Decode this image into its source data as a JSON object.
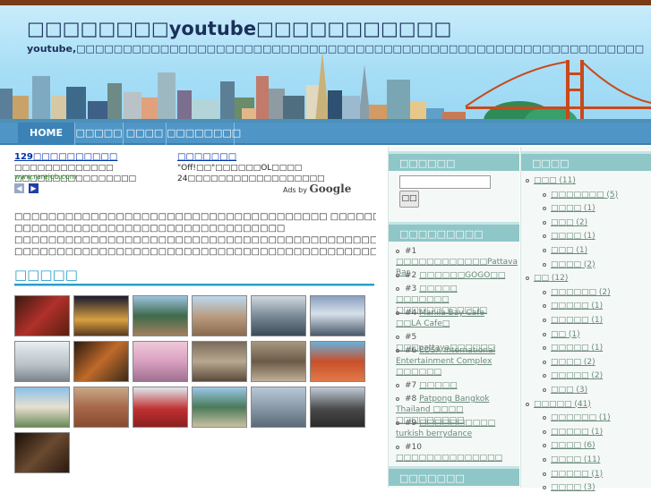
{
  "header": {
    "title": "□□□□□□□□youtube□□□□□□□□□□□",
    "description": "youtube,□□□□□□□□□□□□□□□□□□□□□□□□□□□□□□□□□□□□□□□□□□□□□□□□□□□□□□□□□□□□□□"
  },
  "nav": {
    "items": [
      "HOME",
      "□□□□□",
      "□□□□",
      "□□□□□□□□"
    ]
  },
  "ads": {
    "ad1": {
      "title": "129□□□□□□□□□□",
      "text": "□□□□□□□□□□□□□ □□□□□□□□□□□□□□□□",
      "url": "www.rarejob.com"
    },
    "ad2": {
      "title": "□□□□□□□",
      "text": "\"Off!□□\"□□□□□□OL□□□□ 24□□□□□□□□□□□□□□□□□□"
    },
    "ads_by": "Ads by",
    "ads_by_brand": "Google"
  },
  "main": {
    "paragraphs": [
      "□□□□□□□□□□□□□□□□□□□□□□□□□□□□□□□□□□□□□ □□□□□□□□□□□□□□□□□□□□□□□□□□□□□□□□",
      "□□□□□□□□□□□□□□□□□□□□□□□□□□□□□□□□",
      "□□□□□□□□□□□□□□□□□□□□□□□□□□□□□□□□□□□□□□□□□□□□□□□",
      "□□□□□□□□□□□□□□□□□□□□□□□□□□□□□□□□□□□□□□□□□□□□□□□□□□□□□□□□□□□□□□□□□□□□□□□□"
    ],
    "photos_heading": "□□□□□"
  },
  "sidebar_left": {
    "search_title": "□□□□□□",
    "search_button": "□□",
    "ranking_title": "□□□□□□□□□",
    "ranking": [
      {
        "num": "#1",
        "text": "□□□□□□□□□□□□Pattava Bar"
      },
      {
        "num": "#2",
        "text": "□□□□□□GOGO□□"
      },
      {
        "num": "#3",
        "text": "□□□□□ □□□□□□□ □□□□□□□□□□□□"
      },
      {
        "num": "#4",
        "text": "Manila Bay Cafe □□LA Cafe□"
      },
      {
        "num": "#5",
        "text": "□□□pattaya□□□□□□"
      },
      {
        "num": "#6",
        "text": "EDSA International Entertainment Complex □□□□□□"
      },
      {
        "num": "#7",
        "text": "□□□□□"
      },
      {
        "num": "#8",
        "text": "Patpong Bangkok Thailand □□□□ □□□□□□□□□"
      },
      {
        "num": "#9",
        "text": "□□□□□□□□□□ turkish berrydance"
      },
      {
        "num": "#10",
        "text": "□□□□□□□□□□□□□□"
      }
    ],
    "bottom_title": "□□□□□□□"
  },
  "sidebar_right": {
    "title": "□□□□",
    "categories": [
      {
        "label": "□□□ (11)",
        "level": 1
      },
      {
        "label": "□□□□□□□ (5)",
        "level": 2
      },
      {
        "label": "□□□□ (1)",
        "level": 2
      },
      {
        "label": "□□□ (2)",
        "level": 2
      },
      {
        "label": "□□□□ (1)",
        "level": 2
      },
      {
        "label": "□□□ (1)",
        "level": 2
      },
      {
        "label": "□□□□ (2)",
        "level": 2
      },
      {
        "label": "□□ (12)",
        "level": 1
      },
      {
        "label": "□□□□□□ (2)",
        "level": 2
      },
      {
        "label": "□□□□□ (1)",
        "level": 2
      },
      {
        "label": "□□□□□ (1)",
        "level": 2
      },
      {
        "label": "□□ (1)",
        "level": 2
      },
      {
        "label": "□□□□□ (1)",
        "level": 2
      },
      {
        "label": "□□□□ (2)",
        "level": 2
      },
      {
        "label": "□□□□□ (2)",
        "level": 2
      },
      {
        "label": "□□□ (3)",
        "level": 2
      },
      {
        "label": "□□□□□ (41)",
        "level": 1
      },
      {
        "label": "□□□□□□ (1)",
        "level": 2
      },
      {
        "label": "□□□□□ (1)",
        "level": 2
      },
      {
        "label": "□□□□ (6)",
        "level": 2
      },
      {
        "label": "□□□□ (11)",
        "level": 2
      },
      {
        "label": "□□□□□ (1)",
        "level": 2
      },
      {
        "label": "□□□□ (3)",
        "level": 2
      }
    ]
  },
  "colors": {
    "nav": "#4f96c6",
    "accent": "#2a9ec9",
    "widget_title": "#8fc7c8",
    "top_bar": "#7a3b16"
  }
}
